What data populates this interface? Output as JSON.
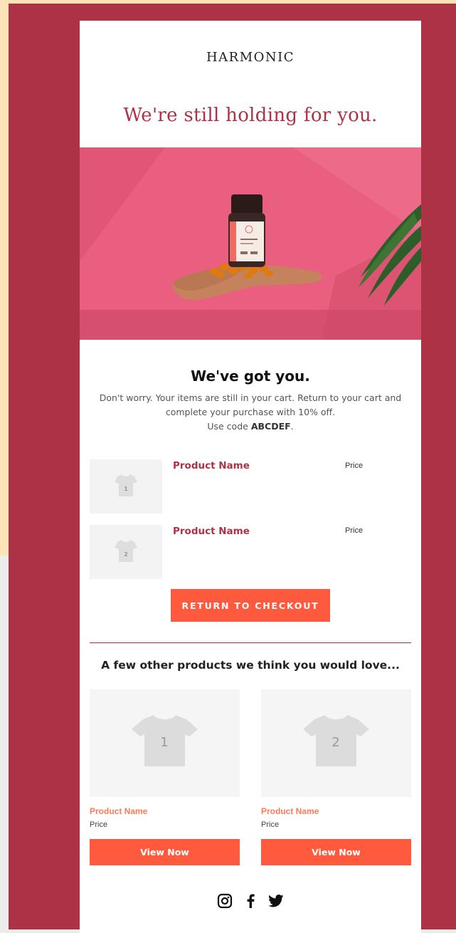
{
  "email": {
    "brand": "HARMONIC",
    "headline": "We're still holding for you.",
    "title": "We've got you.",
    "message_line1": "Don't worry. Your items are still in your cart. Return to your cart and complete your purchase with 10% off.",
    "code_prefix": "Use code ",
    "code": "ABCDEF",
    "code_suffix": ".",
    "cart_items": [
      {
        "name": "Product Name",
        "price": "Price",
        "thumb_number": "1"
      },
      {
        "name": "Product Name",
        "price": "Price",
        "thumb_number": "2"
      }
    ],
    "cta_label": "RETURN TO CHECKOUT",
    "recommend_title": "A few other products we think you would love...",
    "recommendations": [
      {
        "name": "Product Name",
        "price": "Price",
        "button": "View Now",
        "thumb_number": "1"
      },
      {
        "name": "Product Name",
        "price": "Price",
        "button": "View Now",
        "thumb_number": "2"
      }
    ],
    "social_icons": [
      "instagram-icon",
      "facebook-icon",
      "twitter-icon"
    ]
  },
  "colors": {
    "brand_red": "#ad3246",
    "accent_orange": "#ff5a3d",
    "hero_pink": "#ea5f7f",
    "recommend_name": "#ff7a55"
  }
}
